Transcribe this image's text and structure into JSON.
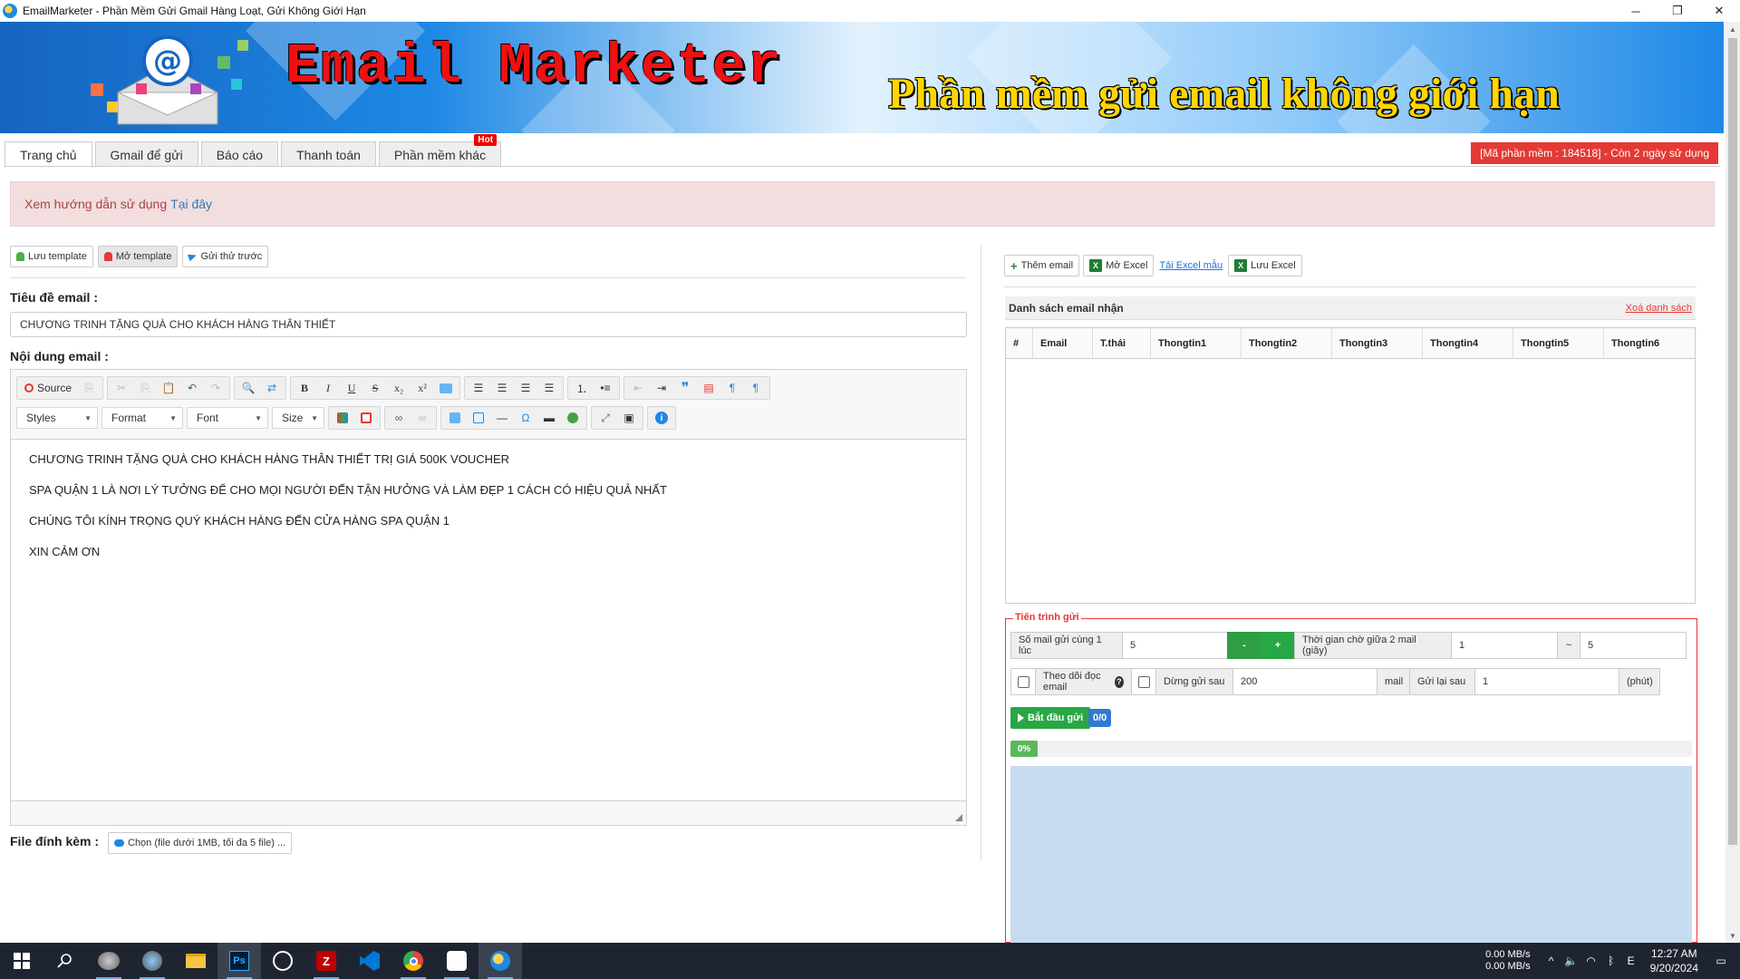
{
  "window": {
    "title": "EmailMarketer - Phần Mềm Gửi Gmail Hàng Loạt, Gửi Không Giới Hạn",
    "minimize": "─",
    "restore": "❐",
    "close": "✕"
  },
  "banner": {
    "brand": "Email Marketer",
    "slogan": "Phần mềm gửi email không giới hạn"
  },
  "tabs": [
    {
      "label": "Trang chủ",
      "active": true
    },
    {
      "label": "Gmail để gửi"
    },
    {
      "label": "Báo cáo"
    },
    {
      "label": "Thanh toán"
    },
    {
      "label": "Phần mềm khác",
      "badge": "Hot"
    }
  ],
  "license": "[Mã phần mềm : 184518] - Còn 2 ngày sử dụng",
  "notice": {
    "text": "Xem hướng dẫn sử dụng",
    "link": "Tại đây"
  },
  "left": {
    "save_template": "Lưu template",
    "open_template": "Mở template",
    "send_test": "Gửi thử trước",
    "subject_label": "Tiêu đề email :",
    "subject_value": "CHƯƠNG TRINH TẶNG QUÀ CHO KHÁCH HÀNG THÂN THIẾT",
    "content_label": "Nội dung email :",
    "attach_label": "File đính kèm :",
    "attach_button": "Chọn (file dưới 1MB, tối đa 5 file) ..."
  },
  "editor": {
    "source_label": "Source",
    "toolbar_glyphs": {
      "copy": "⎘",
      "cut": "✂",
      "paste": "📋",
      "undo": "↶",
      "redo": "↷",
      "find": "🔍",
      "replace": "⇄",
      "bold": "B",
      "italic": "I",
      "underline": "U",
      "strike": "S",
      "sub": "x₂",
      "sup": "x²",
      "omega": "Ω",
      "info": "i",
      "quote": "❞",
      "ltr": "¶",
      "rtl": "¶"
    },
    "combos": {
      "styles": "Styles",
      "format": "Format",
      "font": "Font",
      "size": "Size"
    },
    "lines": [
      "CHƯƠNG TRINH TẶNG QUÀ CHO KHÁCH HÀNG THÂN THIẾT TRỊ GIÁ 500K VOUCHER",
      "SPA QUẬN 1 LÀ NƠI LÝ TƯỞNG ĐỂ CHO MỌI NGƯỜI ĐẾN TẬN HƯỞNG VÀ LÀM ĐẸP 1 CÁCH CÓ HIỆU QUẢ NHẤT",
      "CHÚNG TÔI KÍNH TRỌNG QUÝ KHÁCH HÀNG ĐẾN CỬA HÀNG SPA QUẬN 1",
      "XIN CẢM ƠN"
    ]
  },
  "right": {
    "add_email": "Thêm email",
    "open_excel": "Mở Excel",
    "download_sample": "Tải Excel mẫu",
    "save_excel": "Lưu Excel",
    "xls_glyph": "X",
    "list_title": "Danh sách email nhận",
    "clear_list": "Xoá danh sách",
    "columns": [
      "#",
      "Email",
      "T.thái",
      "Thongtin1",
      "Thongtin2",
      "Thongtin3",
      "Thongtin4",
      "Thongtin5",
      "Thongtin6"
    ]
  },
  "process": {
    "legend": "Tiến trình gửi",
    "concurrent_label": "Số mail gửi cùng 1 lúc",
    "concurrent_value": "5",
    "minus": "-",
    "plus": "+",
    "wait_label": "Thời gian chờ giữa 2 mail (giây)",
    "wait_min": "1",
    "tilde": "~",
    "wait_max": "5",
    "track_label": "Theo dõi đọc email",
    "help_glyph": "?",
    "stop_label": "Dừng gửi sau",
    "stop_value": "200",
    "stop_unit": "mail",
    "resend_label": "Gửi lại sau",
    "resend_value": "1",
    "resend_unit": "(phút)",
    "start_button": "Bắt đầu gửi",
    "counter": "0/0",
    "progress_text": "0%",
    "progress_fraction": 0.04
  },
  "taskbar": {
    "net_up": "0.00 MB/s",
    "net_down": "0.00 MB/s",
    "time": "12:27 AM",
    "date": "9/20/2024",
    "ime": "E",
    "tray_glyphs": {
      "chevron": "^",
      "speaker": "🔈",
      "wifi": "◠",
      "bluetooth": "ᛒ",
      "notification": "▭"
    }
  }
}
